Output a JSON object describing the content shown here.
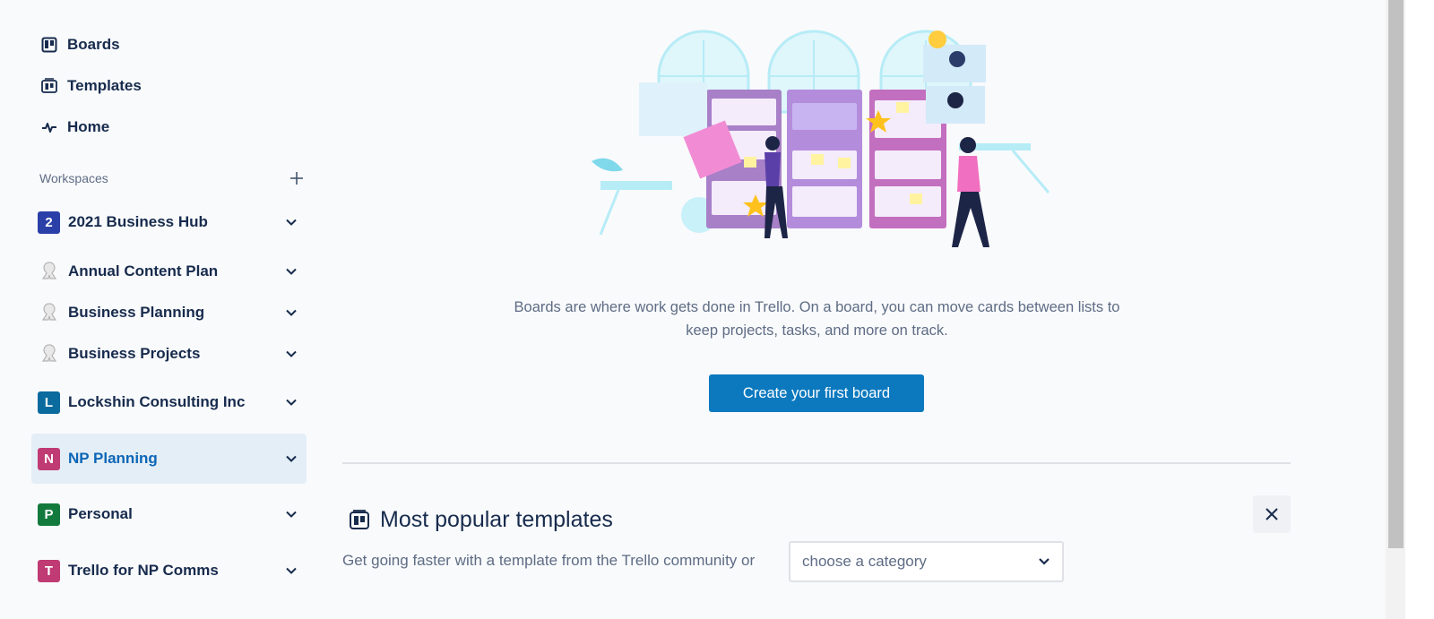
{
  "sidebar": {
    "nav": [
      {
        "label": "Boards",
        "icon": "boards-icon"
      },
      {
        "label": "Templates",
        "icon": "templates-icon"
      },
      {
        "label": "Home",
        "icon": "activity-icon"
      }
    ],
    "workspaces_label": "Workspaces",
    "workspaces": [
      {
        "badge": "2",
        "label": "2021 Business Hub",
        "color": "#2a3fa8"
      },
      {
        "badge": "",
        "label": "Annual Content Plan",
        "color": "logo"
      },
      {
        "badge": "",
        "label": "Business Planning",
        "color": "logo"
      },
      {
        "badge": "",
        "label": "Business Projects",
        "color": "logo"
      },
      {
        "badge": "L",
        "label": "Lockshin Consulting Inc",
        "color": "#0b6a9e"
      },
      {
        "badge": "N",
        "label": "NP Planning",
        "color": "#c03a73"
      },
      {
        "badge": "P",
        "label": "Personal",
        "color": "#137a3d"
      },
      {
        "badge": "T",
        "label": "Trello for NP Comms",
        "color": "#c03a73"
      }
    ]
  },
  "main": {
    "description": "Boards are where work gets done in Trello. On a board, you can move cards between lists to keep projects, tasks, and more on track.",
    "cta_label": "Create your first board",
    "templates": {
      "title": "Most popular templates",
      "subtitle": "Get going faster with a template from the Trello community or",
      "category_placeholder": "choose a category"
    }
  },
  "colors": {
    "accent": "#0c79bf",
    "active_bg": "#e4eef6",
    "active_text": "#0c66b6",
    "text": "#172b4d",
    "muted": "#5e6c84"
  }
}
